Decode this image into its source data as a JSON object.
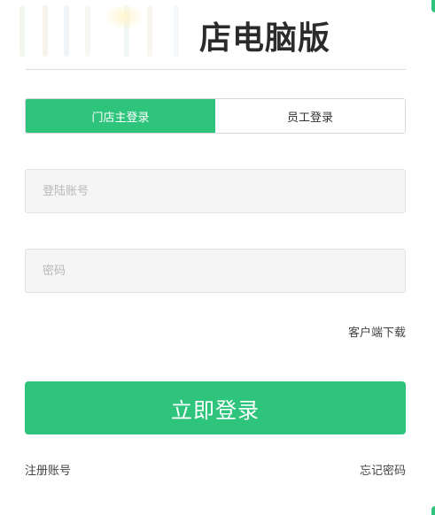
{
  "header": {
    "title": "店电脑版"
  },
  "tabs": [
    {
      "label": "门店主登录",
      "active": true
    },
    {
      "label": "员工登录",
      "active": false
    }
  ],
  "form": {
    "account_placeholder": "登陆账号",
    "account_value": "",
    "password_placeholder": "密码",
    "password_value": ""
  },
  "links": {
    "client_download": "客户端下载",
    "register": "注册账号",
    "forgot_password": "忘记密码"
  },
  "submit": {
    "label": "立即登录"
  },
  "colors": {
    "accent": "#2ec47c",
    "title": "#2b2b2b",
    "input_bg": "#f5f5f5"
  }
}
